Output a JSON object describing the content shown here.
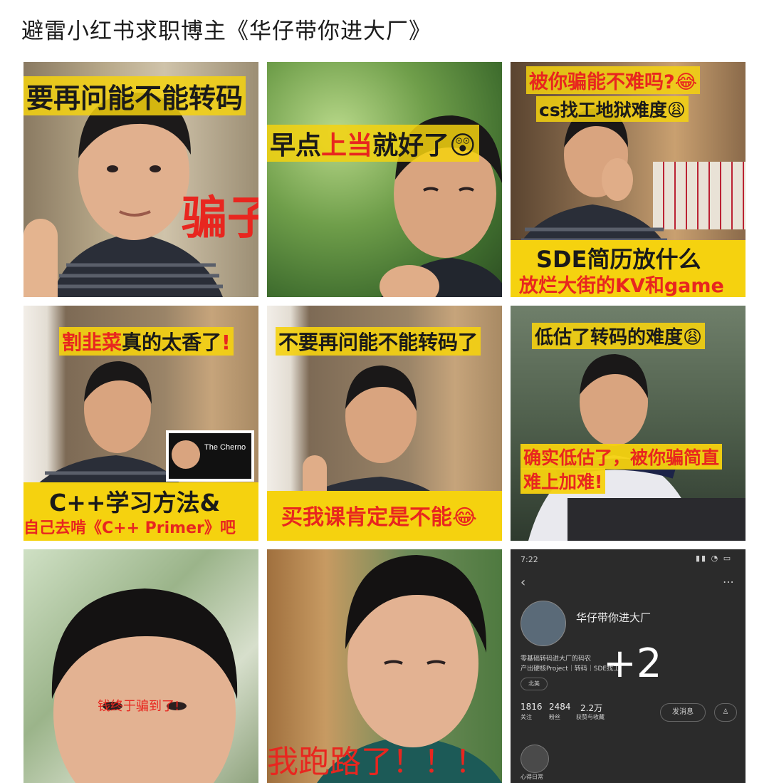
{
  "post_title": "避雷小红书求职博主《华仔带你进大厂》",
  "images": [
    {
      "caption_top": "要再问能不能转码",
      "caption_side": "骗子"
    },
    {
      "caption_parts": [
        "早点",
        "上当",
        "就好了"
      ],
      "emoji": "😲"
    },
    {
      "line1": "被你骗能不难吗?",
      "emoji1": "😂",
      "line2": "cs找工地狱难度",
      "emoji2": "😩",
      "bar1": "SDE简历放什么",
      "bar2": "放烂大街的KV和game"
    },
    {
      "top_red": "割韭菜",
      "top_rest": "真的太香了",
      "top_bang": "!",
      "card_name": "The Cherno",
      "bar1": "C++学习方法&",
      "bar2": "自己去啃《C++ Primer》吧"
    },
    {
      "caption_top": "不要再问能不能转码了",
      "bar": "买我课肯定是不能",
      "emoji": "😂"
    },
    {
      "caption_top": "低估了转码的难度",
      "emoji": "😩",
      "red1": "确实低估了，被你骗简直",
      "red2": "难上加难!"
    },
    {
      "caption": "钱终于骗到了!"
    },
    {
      "caption": "我跑路了！！！"
    },
    {
      "status_time": "7:22",
      "profile_name": "华仔带你进大厂",
      "bio1": "零基础转码进大厂的码农",
      "bio2": "产出硬核Project｜转码｜SDE找工",
      "tag": "北美",
      "stat_following": "1816",
      "stat_following_label": "关注",
      "stat_fans": "2484",
      "stat_fans_label": "粉丝",
      "stat_likes": "2.2万",
      "stat_likes_label": "获赞与收藏",
      "msg_button": "发消息",
      "more_count": "+2",
      "section_label": "心得日常"
    }
  ],
  "colors": {
    "caption_red": "#e8261f",
    "caption_yellow": "#f5d20f",
    "text_black": "#1a1a1a"
  }
}
